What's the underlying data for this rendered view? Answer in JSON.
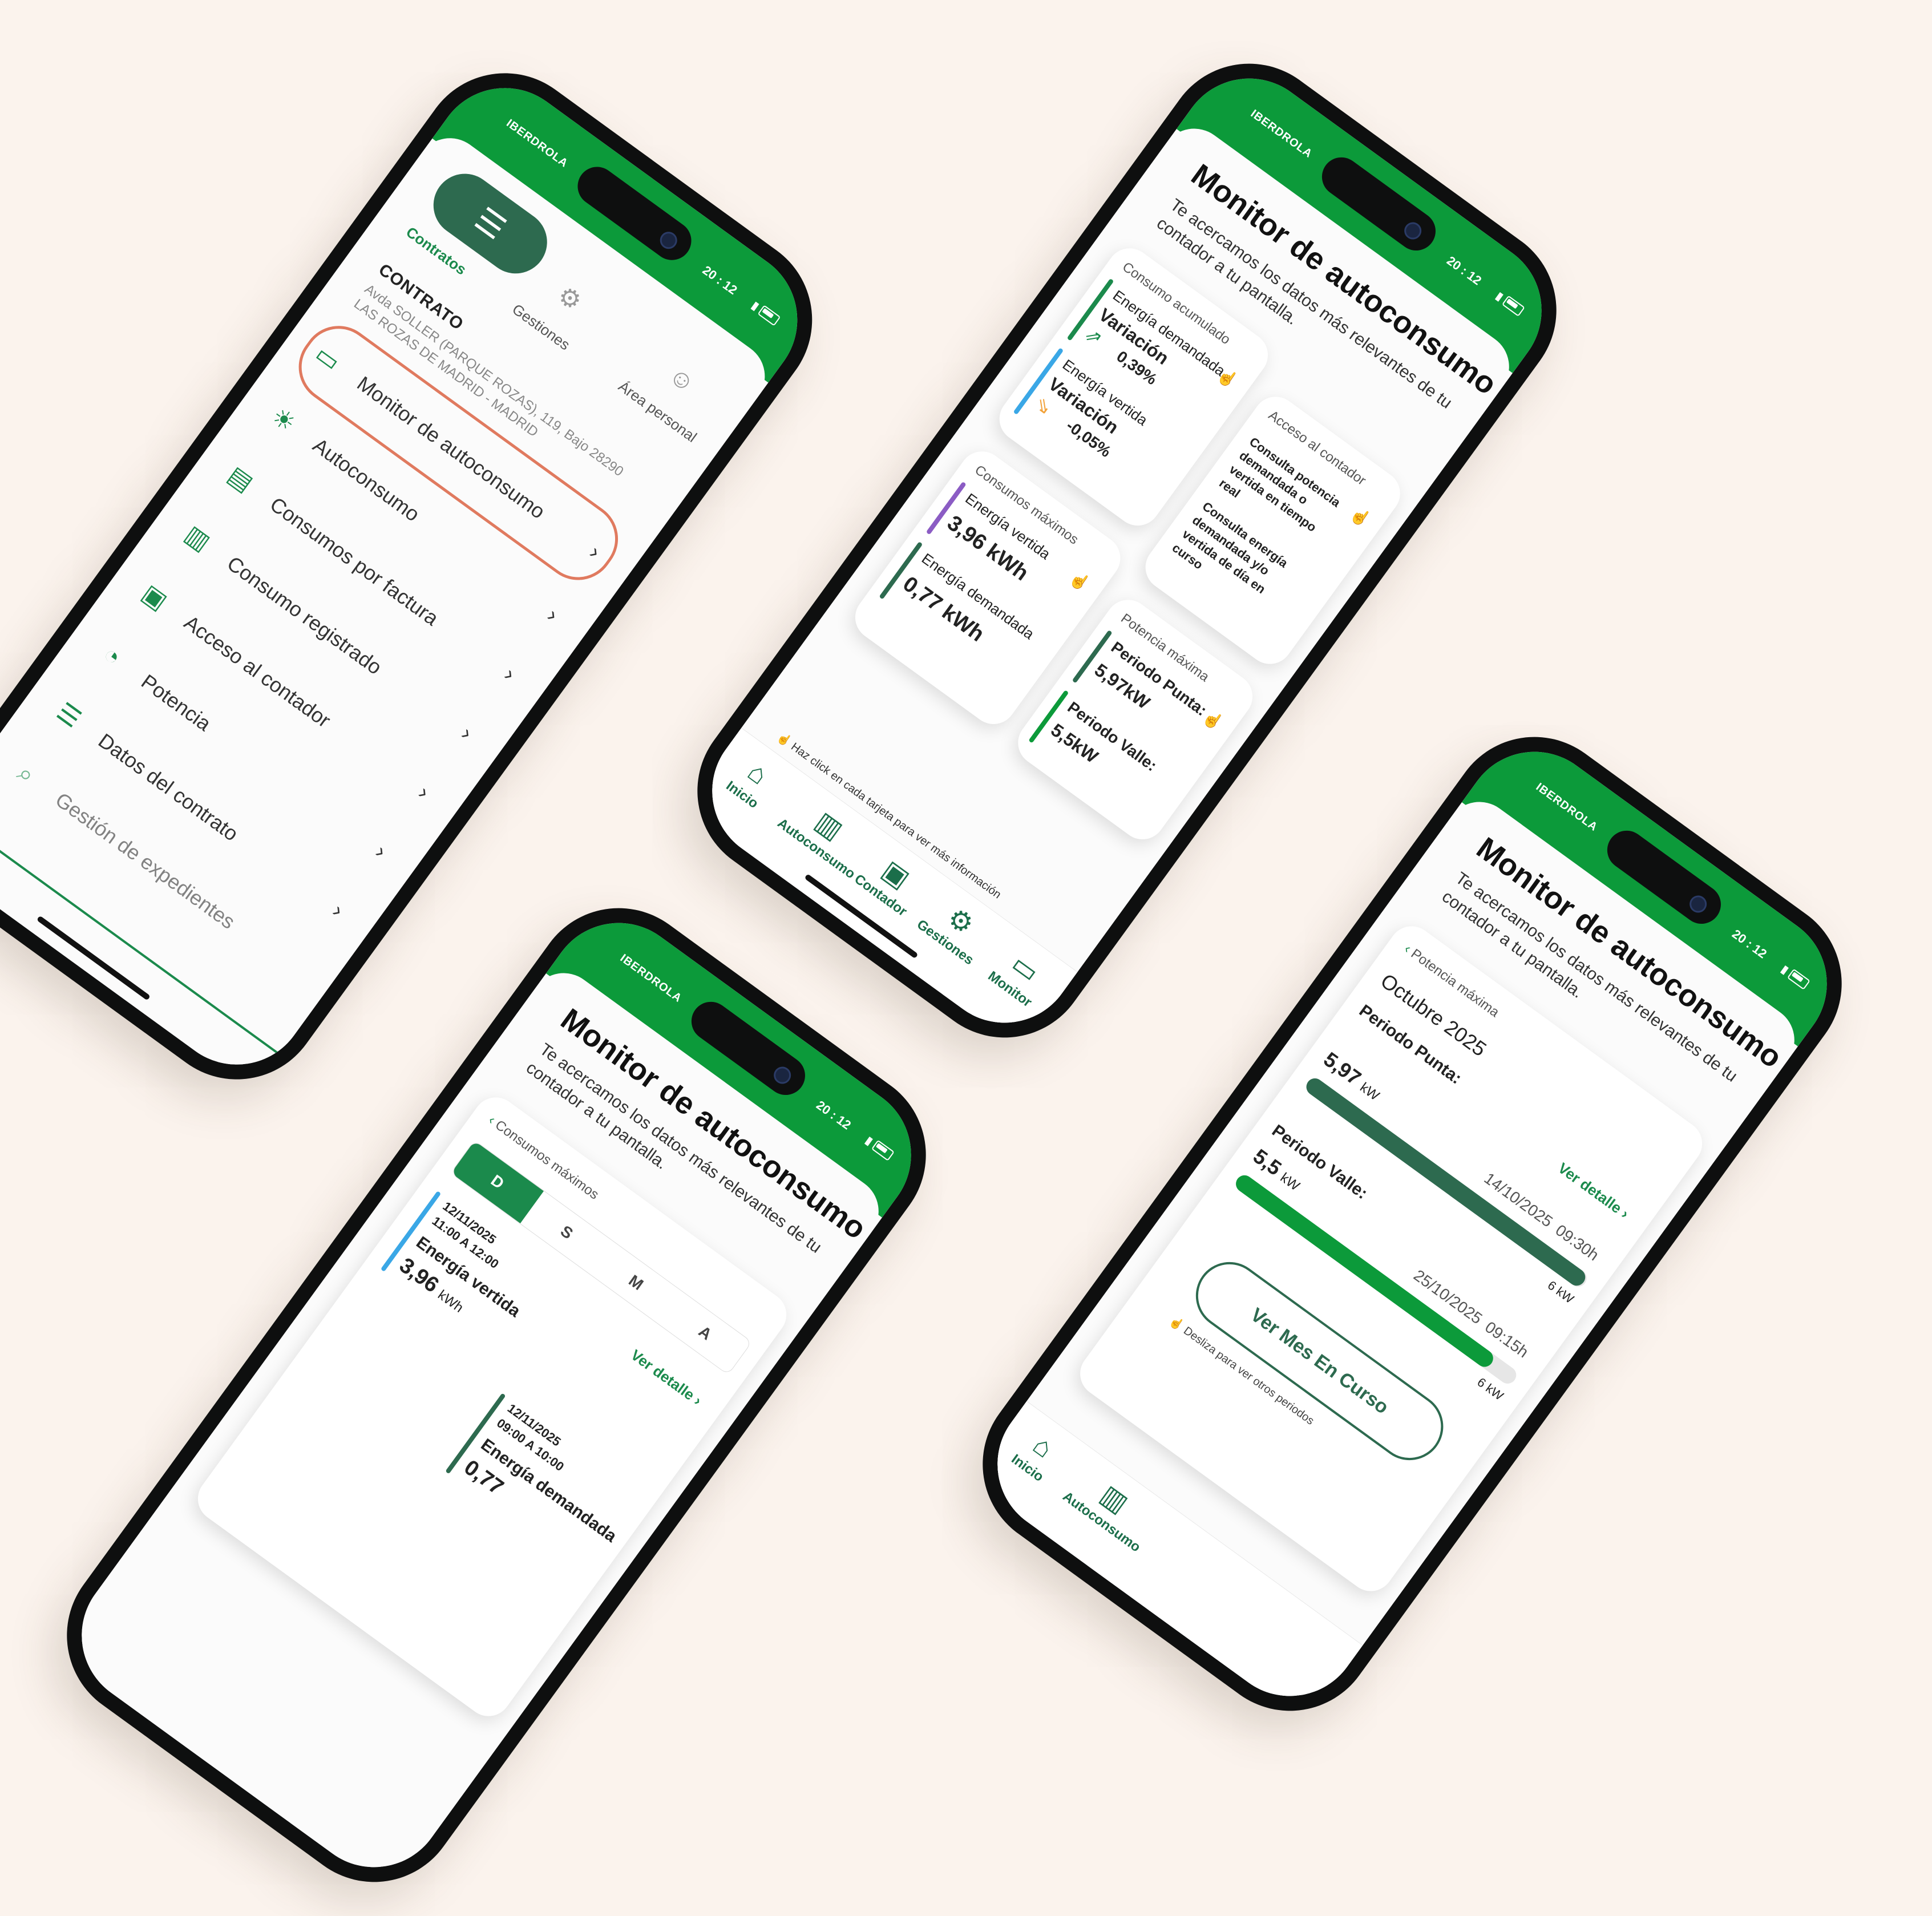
{
  "brand": "IBERDROLA",
  "status_time": "20 : 12",
  "phone1": {
    "tabs": [
      {
        "label": "Contratos"
      },
      {
        "label": "Gestiones"
      },
      {
        "label": "Área personal"
      }
    ],
    "contract_heading": "CONTRATO",
    "contract_address": "Avda SOLLER (PARQUE ROZAS), 119, Bajo 28290 LAS ROZAS DE MADRID - MADRID",
    "menu": [
      {
        "label": "Monitor de autoconsumo",
        "icon": "monitor-icon"
      },
      {
        "label": "Autoconsumo",
        "icon": "solar-panel-icon"
      },
      {
        "label": "Consumos por factura",
        "icon": "invoice-icon"
      },
      {
        "label": "Consumo registrado",
        "icon": "bar-chart-icon"
      },
      {
        "label": "Acceso al contador",
        "icon": "meter-icon"
      },
      {
        "label": "Potencia",
        "icon": "gauge-icon"
      },
      {
        "label": "Datos del contrato",
        "icon": "document-icon"
      }
    ],
    "footer_partial": "Gestión de expedientes"
  },
  "monitor": {
    "title": "Monitor de autoconsumo",
    "subtitle": "Te acercamos los datos más relevantes de tu contador a tu pantalla."
  },
  "phone2": {
    "card_acumulado": {
      "title": "Consumo acumulado",
      "demandada_label": "Energía demandada",
      "variacion_label": "Variación",
      "demandada_value": "0,39%",
      "vertida_label": "Energía vertida",
      "vertida_value": "-0,05%"
    },
    "card_contador": {
      "title": "Acceso al contador",
      "item1": "Consulta potencia demandada o vertida en tiempo real",
      "item2": "Consulta energía demandada y/o vertida de día en curso"
    },
    "card_maximos": {
      "title": "Consumos máximos",
      "vertida_label": "Energía vertida",
      "vertida_value": "3,96 kWh",
      "demandada_label": "Energía demandada",
      "demandada_value": "0,77 kWh"
    },
    "card_potencia": {
      "title": "Potencia máxima",
      "punta_label": "Periodo Punta:",
      "punta_value": "5,97kW",
      "valle_label": "Periodo Valle:",
      "valle_value": "5,5kW"
    },
    "hint": "Haz click en cada tarjeta para ver más información",
    "nav": [
      {
        "label": "Inicio",
        "icon": "home-icon"
      },
      {
        "label": "Autoconsumo",
        "icon": "bar-chart-icon"
      },
      {
        "label": "Contador",
        "icon": "meter-icon"
      },
      {
        "label": "Gestiones",
        "icon": "gear-icon"
      },
      {
        "label": "Monitor",
        "icon": "monitor-icon"
      }
    ]
  },
  "phone3": {
    "back_label": "Consumos máximos",
    "period_tabs": [
      "D",
      "S",
      "M",
      "A"
    ],
    "active_tab": "D",
    "ver_detalle": "Ver detalle",
    "entry1": {
      "date": "12/11/2025",
      "range": "11:00 A 12:00",
      "label": "Energía vertida",
      "value": "3,96",
      "unit": "kWh"
    },
    "entry2": {
      "date": "12/11/2025",
      "range": "09:00 A 10:00",
      "label": "Energía demandada",
      "value": "0,77"
    }
  },
  "phone4": {
    "back_label": "Potencia máxima",
    "month": "Octubre 2025",
    "ver_detalle": "Ver detalle",
    "punta_label": "Periodo Punta:",
    "punta_value": "5,97",
    "punta_unit": "kW",
    "punta_date": "14/10/2025",
    "punta_time": "09:30h",
    "punta_max": "6 kW",
    "valle_label": "Periodo Valle:",
    "valle_value": "5,5",
    "valle_unit": "kW",
    "valle_date": "25/10/2025",
    "valle_time": "09:15h",
    "valle_max": "6 kW",
    "button": "Ver Mes En Curso",
    "swipe_hint": "Desliza para ver otros periodos",
    "nav": [
      {
        "label": "Inicio",
        "icon": "home-icon"
      },
      {
        "label": "Autoconsumo",
        "icon": "bar-chart-icon"
      }
    ],
    "chart_data": {
      "type": "bar",
      "categories": [
        "Periodo Punta:",
        "Periodo Valle:"
      ],
      "values": [
        5.97,
        5.5
      ],
      "max": 6,
      "unit": "kW"
    }
  }
}
